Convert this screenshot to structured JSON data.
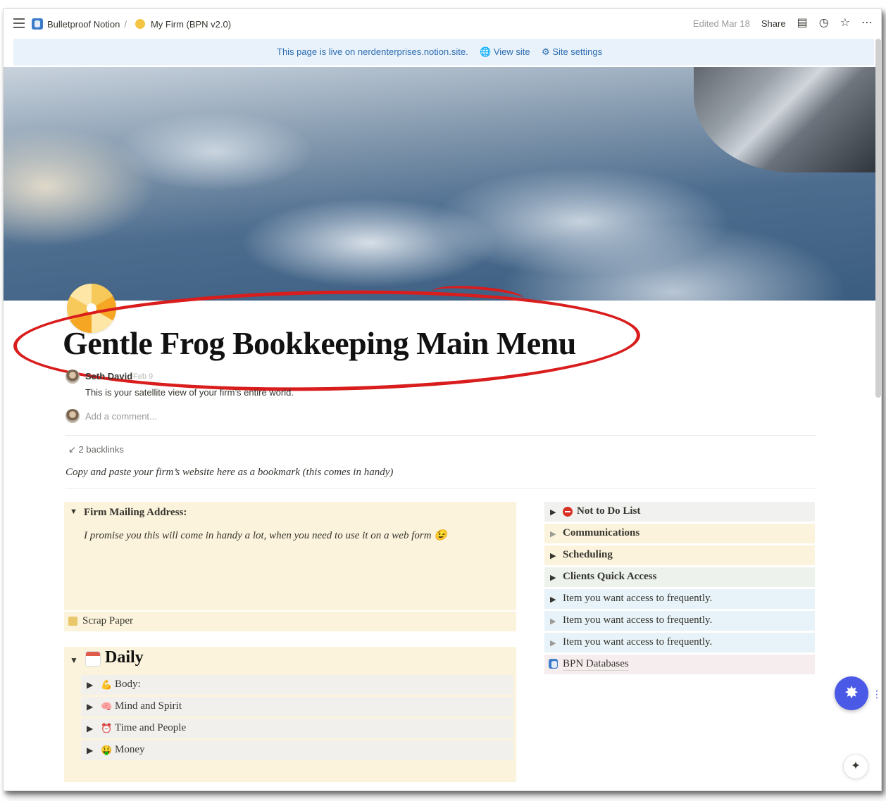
{
  "topbar": {
    "breadcrumb_root": "Bulletproof Notion",
    "breadcrumb_sep": "/",
    "breadcrumb_page": "My Firm (BPN v2.0)",
    "edited": "Edited Mar 18",
    "share": "Share",
    "icons": [
      "hamburger-icon",
      "comment-icon",
      "clock-icon",
      "star-icon",
      "more-icon"
    ]
  },
  "live_banner": {
    "text": "This page is live on nerdenterprises.notion.site.",
    "view_site": "View site",
    "site_settings": "Site settings"
  },
  "page": {
    "title": "Gentle Frog Bookkeeping Main Menu"
  },
  "comments": {
    "author": "Seth David",
    "date": "Feb 9",
    "text": "This is your satellite view of your firm’s entire world.",
    "add_placeholder": "Add a comment..."
  },
  "backlinks": "2 backlinks",
  "bookmark_hint": "Copy and paste your firm’s website here as a bookmark (this comes in handy)",
  "left": {
    "mailing_title": "Firm Mailing Address:",
    "mailing_body": "I promise you this will come in handy a lot, when you need to use it on a web form 😉",
    "scrap": "Scrap Paper",
    "daily_title": "Daily",
    "daily_items": [
      {
        "emoji": "💪",
        "label": "Body:"
      },
      {
        "emoji": "🧠",
        "label": "Mind and Spirit"
      },
      {
        "emoji": "⏰",
        "label": "Time and People"
      },
      {
        "emoji": "🤑",
        "label": "Money"
      }
    ]
  },
  "right": {
    "items": [
      "Not to Do List",
      "Communications",
      "Scheduling",
      "Clients Quick Access",
      "Item you want access to frequently.",
      "Item you want access to frequently.",
      "Item you want access to frequently.",
      "BPN Databases"
    ]
  },
  "colors": {
    "accent_blue": "#2b6cb0",
    "callout_yellow": "#fbf3db",
    "annotation_red": "#d91c1c",
    "fab": "#4b5ae6"
  }
}
